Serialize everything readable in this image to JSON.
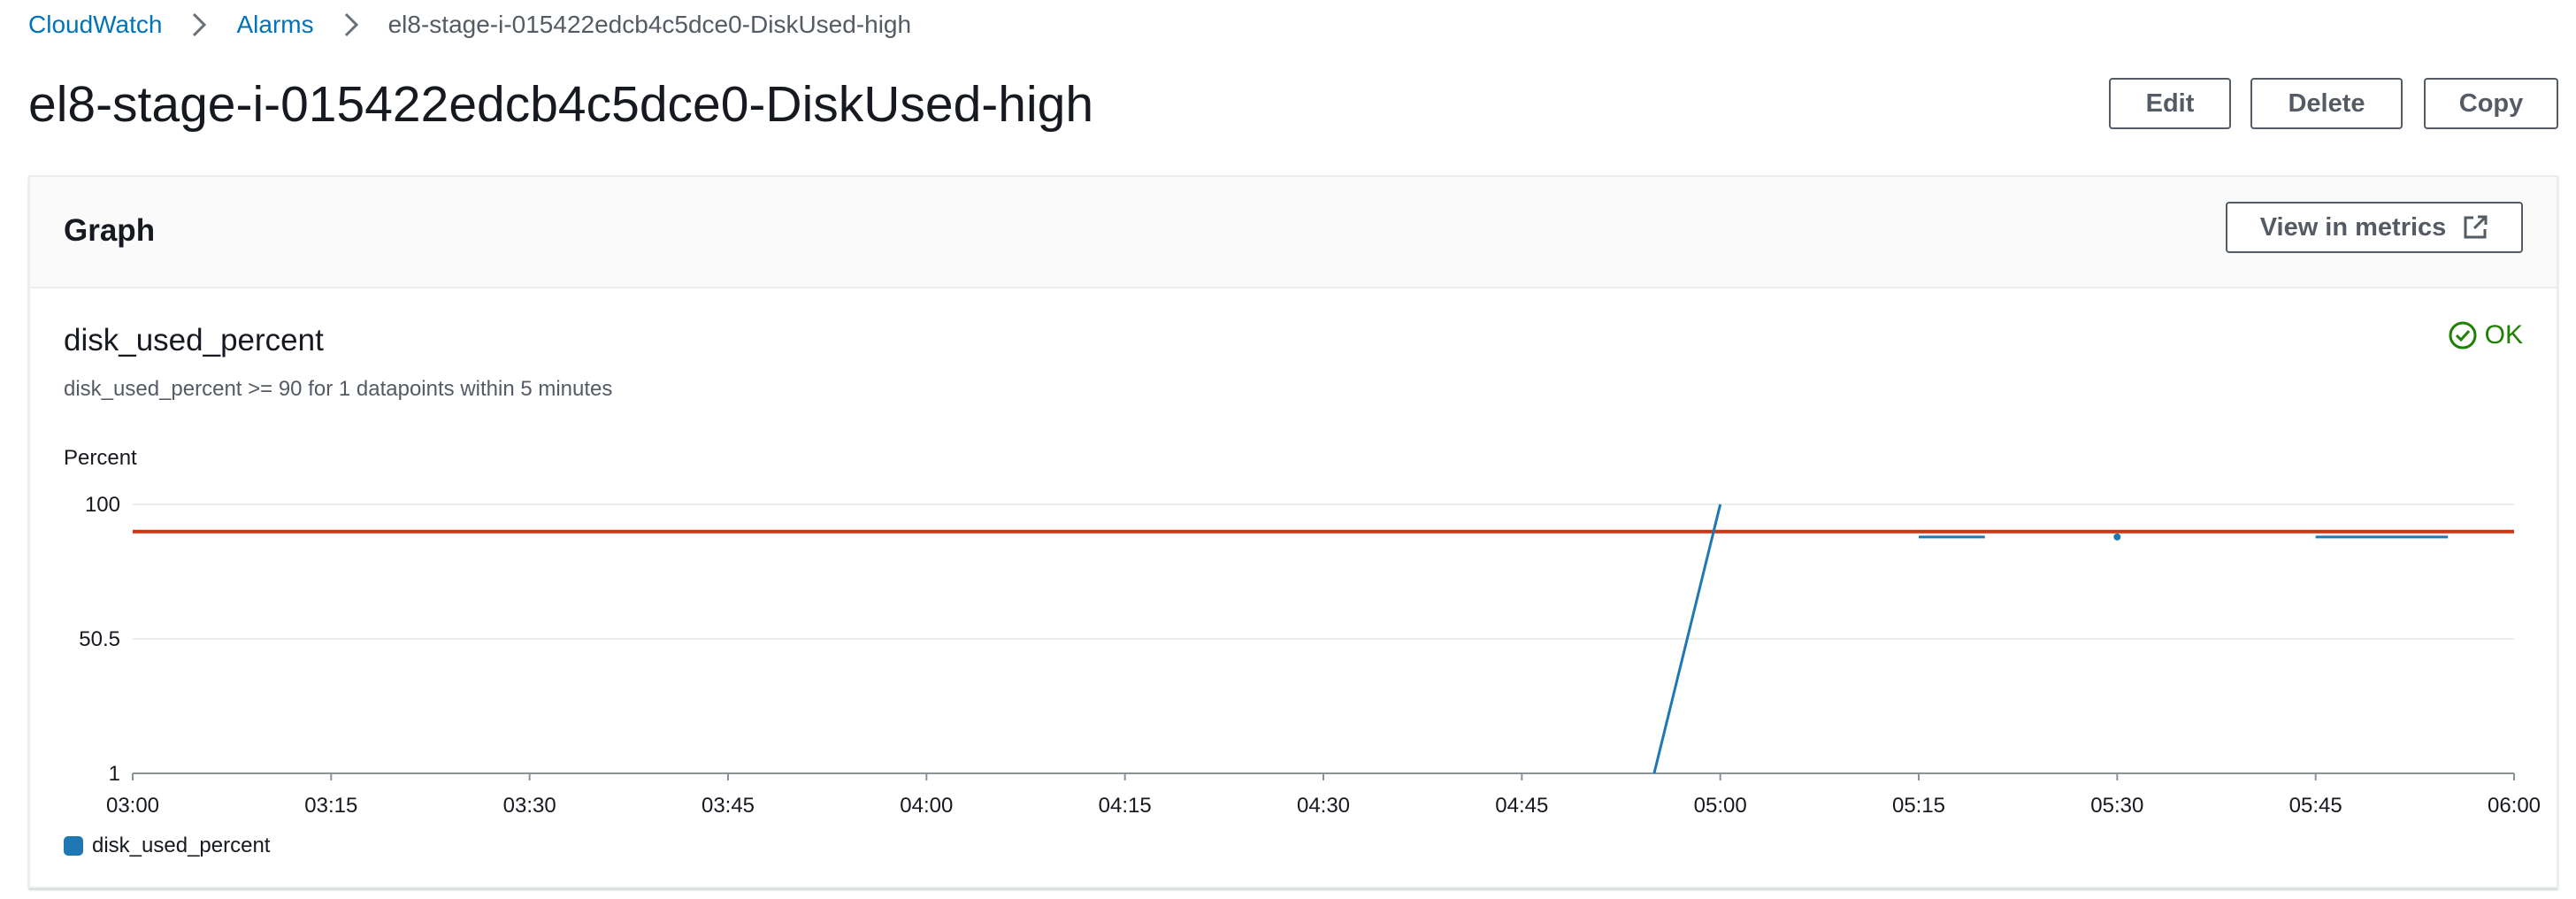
{
  "breadcrumb": {
    "items": [
      "CloudWatch",
      "Alarms"
    ],
    "current": "el8-stage-i-015422edcb4c5dce0-DiskUsed-high"
  },
  "page": {
    "title": "el8-stage-i-015422edcb4c5dce0-DiskUsed-high",
    "actions": {
      "edit": "Edit",
      "delete": "Delete",
      "copy": "Copy"
    }
  },
  "graph_panel": {
    "title": "Graph",
    "view_in_metrics": "View in metrics",
    "metric_name": "disk_used_percent",
    "condition": "disk_used_percent >= 90 for 1 datapoints within 5 minutes",
    "status": "OK",
    "status_color": "#1d8102",
    "y_unit": "Percent",
    "legend": "disk_used_percent"
  },
  "chart_data": {
    "type": "line",
    "ylim": [
      1,
      100
    ],
    "y_ticks": [
      "100",
      "50.5",
      "1"
    ],
    "x_ticks": [
      "03:00",
      "03:15",
      "03:30",
      "03:45",
      "04:00",
      "04:15",
      "04:30",
      "04:45",
      "05:00",
      "05:15",
      "05:30",
      "05:45",
      "06:00"
    ],
    "threshold": {
      "value": 90,
      "color": "#d13212"
    },
    "series": [
      {
        "name": "disk_used_percent",
        "color": "#1f77b4",
        "segments": [
          [
            [
              "04:55",
              1
            ],
            [
              "05:00",
              100
            ]
          ],
          [
            [
              "05:15",
              88
            ],
            [
              "05:20",
              88
            ]
          ],
          [
            [
              "05:30",
              88
            ]
          ],
          [
            [
              "05:45",
              88
            ],
            [
              "05:55",
              88
            ]
          ]
        ]
      }
    ]
  }
}
